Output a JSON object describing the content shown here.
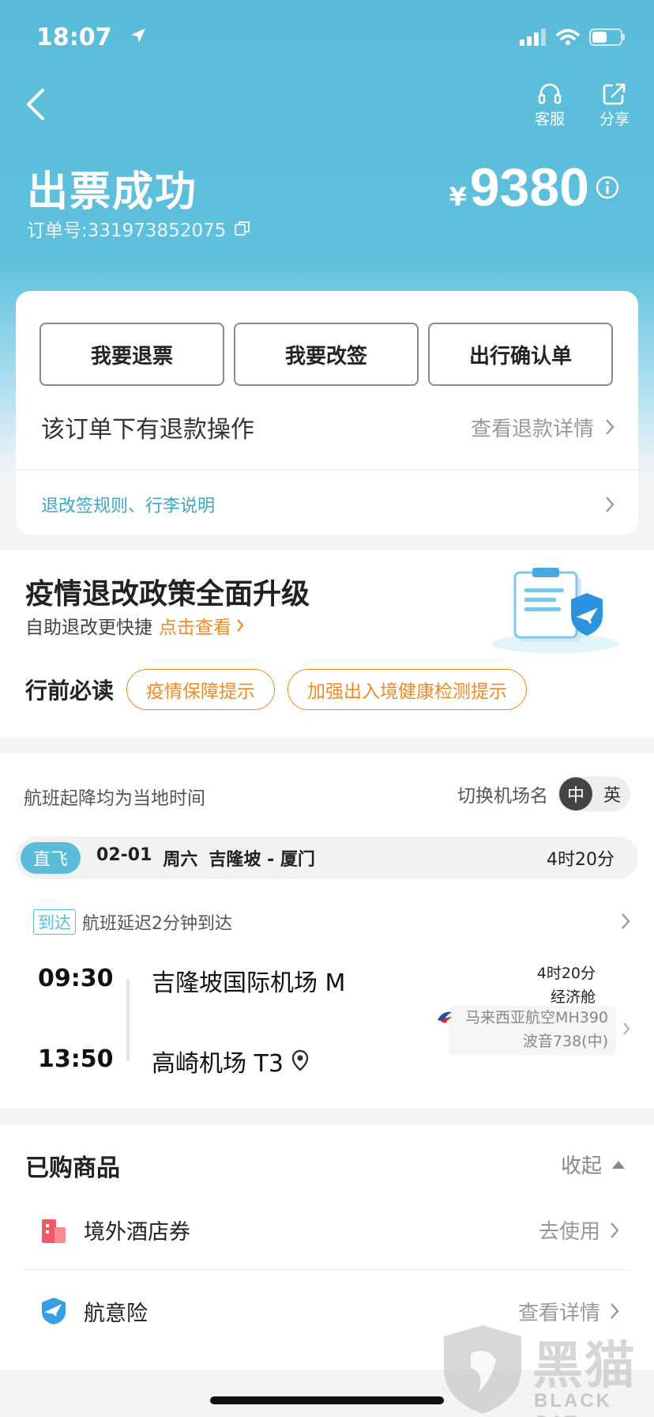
{
  "status_bar": {
    "time": "18:07"
  },
  "header": {
    "service_label": "客服",
    "share_label": "分享",
    "title": "出票成功",
    "order_no": "订单号:331973852075",
    "currency": "¥",
    "price": "9380"
  },
  "actions": {
    "refund_label": "我要退票",
    "change_label": "我要改签",
    "confirm_label": "出行确认单",
    "refund_notice": "该订单下有退款操作",
    "refund_detail": "查看退款详情",
    "rules_link": "退改签规则、行李说明"
  },
  "policy": {
    "heading": "疫情退改政策全面升级",
    "sub_text": "自助退改更快捷",
    "sub_link": "点击查看",
    "must_read_label": "行前必读",
    "tags": [
      "疫情保障提示",
      "加强出入境健康检测提示"
    ]
  },
  "flight": {
    "local_time_note": "航班起降均为当地时间",
    "switch_label": "切换机场名",
    "lang_cn": "中",
    "lang_en": "英",
    "direct_label": "直飞",
    "date": "02-01",
    "weekday": "周六",
    "route": "吉隆坡 - 厦门",
    "total_duration": "4时20分",
    "arrival_tag": "到达",
    "delay_text": "航班延迟2分钟到达",
    "dep_time": "09:30",
    "dep_airport": "吉隆坡国际机场 M",
    "arr_time": "13:50",
    "arr_airport": "高崎机场 T3",
    "duration": "4时20分",
    "cabin": "经济舱",
    "airline": "马来西亚航空MH390",
    "aircraft": "波音738(中)"
  },
  "products": {
    "heading": "已购商品",
    "collapse_label": "收起",
    "items": [
      {
        "name": "境外酒店券",
        "action": "去使用"
      },
      {
        "name": "航意险",
        "action": "查看详情"
      }
    ]
  },
  "watermark": {
    "text": "黑猫",
    "sub": "BLACK CAT"
  },
  "colors": {
    "brand": "#5bbcd9",
    "accent": "#f08a22"
  }
}
